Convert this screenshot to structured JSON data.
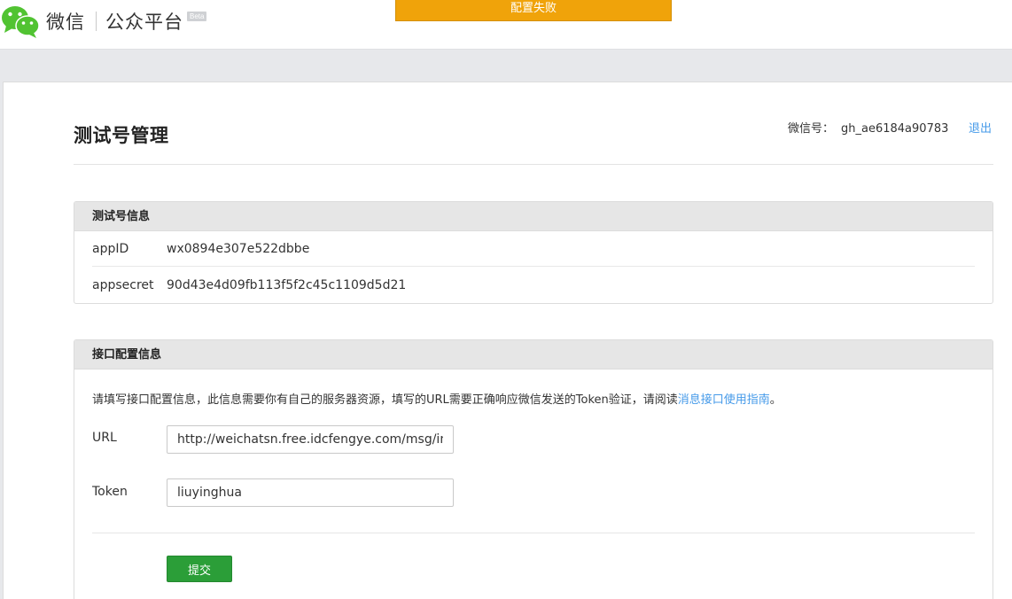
{
  "header": {
    "logo_wechat": "微信",
    "logo_platform": "公众平台",
    "logo_beta": "Beta",
    "alert": "配置失败"
  },
  "page": {
    "title": "测试号管理",
    "account_label": "微信号：",
    "account_id": "gh_ae6184a90783",
    "logout": "退出"
  },
  "test_info": {
    "heading": "测试号信息",
    "rows": [
      {
        "key": "appID",
        "value": "wx0894e307e522dbbe"
      },
      {
        "key": "appsecret",
        "value": "90d43e4d09fb113f5f2c45c1109d5d21"
      }
    ]
  },
  "api_config": {
    "heading": "接口配置信息",
    "description": "请填写接口配置信息，此信息需要你有自己的服务器资源，填写的URL需要正确响应微信发送的Token验证，请阅读",
    "guide_link": "消息接口使用指南",
    "description_end": "。",
    "url_label": "URL",
    "url_value": "http://weichatsn.free.idcfengye.com/msg/ind",
    "token_label": "Token",
    "token_value": "liuyinghua",
    "submit_label": "提交"
  },
  "colors": {
    "accent_link": "#459ae9",
    "alert_bg": "#f0a30a",
    "submit_bg": "#2b9e38",
    "wechat_green": "#51c332"
  }
}
